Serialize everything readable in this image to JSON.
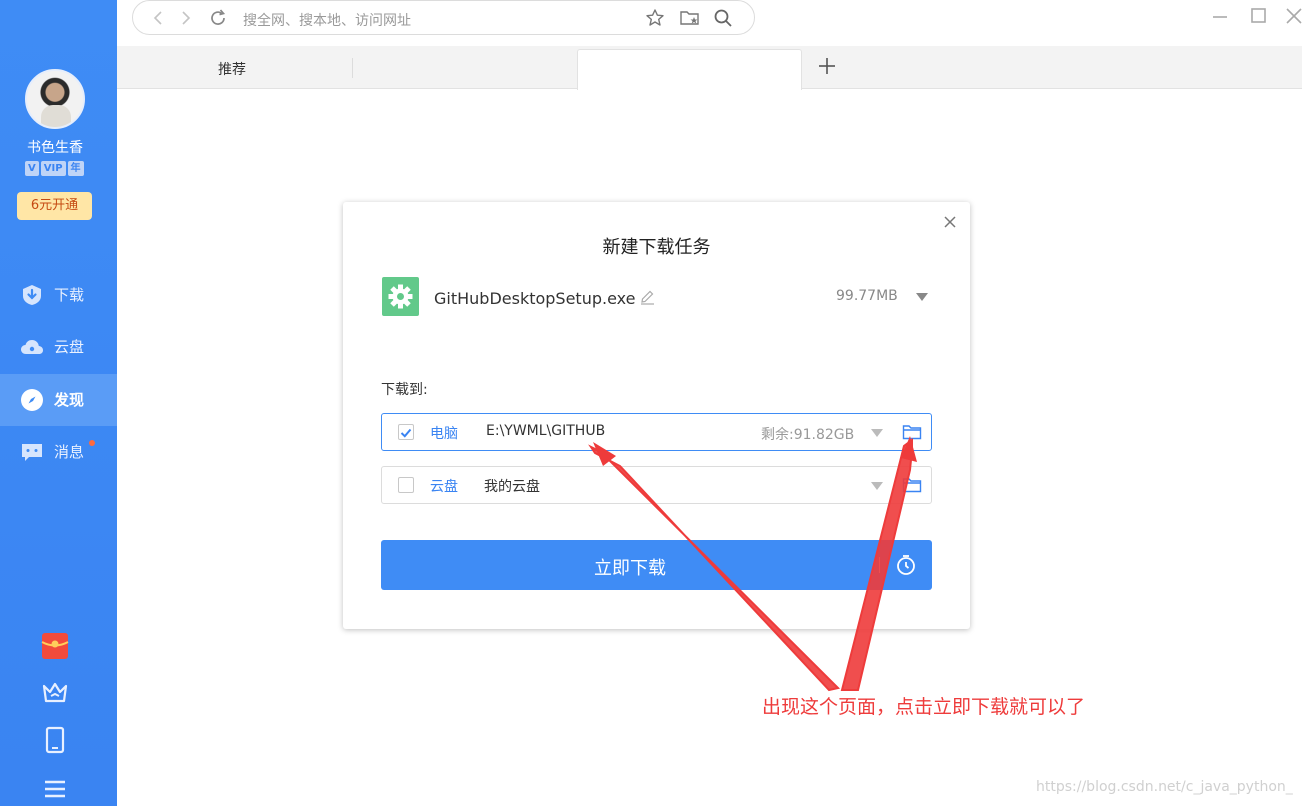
{
  "sidebar": {
    "username": "书色生香",
    "vip_badges": [
      "V",
      "VIP",
      "年"
    ],
    "open_button": "6元开通",
    "nav": [
      {
        "label": "下载",
        "icon": "download-shield-icon",
        "active": false
      },
      {
        "label": "云盘",
        "icon": "cloud-icon",
        "active": false
      },
      {
        "label": "发现",
        "icon": "compass-icon",
        "active": true
      },
      {
        "label": "消息",
        "icon": "chat-icon",
        "active": false
      }
    ],
    "bottom_icons": [
      "red-envelope-icon",
      "crown-icon",
      "phone-icon",
      "menu-icon"
    ]
  },
  "browser": {
    "url_placeholder": "搜全网、搜本地、访问网址",
    "tab_label": "推荐"
  },
  "dialog": {
    "title": "新建下载任务",
    "file_name": "GitHubDesktopSetup.exe",
    "file_size": "99.77MB",
    "save_to_label": "下载到:",
    "locations": [
      {
        "type": "电脑",
        "path": "E:\\YWML\\GITHUB",
        "free": "剩余:91.82GB",
        "checked": true
      },
      {
        "type": "云盘",
        "path": "我的云盘",
        "free": "",
        "checked": false
      }
    ],
    "download_button": "立即下载"
  },
  "annotation": "出现这个页面，点击立即下载就可以了",
  "watermark": "https://blog.csdn.net/c_java_python_",
  "colors": {
    "accent": "#3f8cf5",
    "annotation_red": "#ee3b3b",
    "file_icon_green": "#62c98a"
  }
}
